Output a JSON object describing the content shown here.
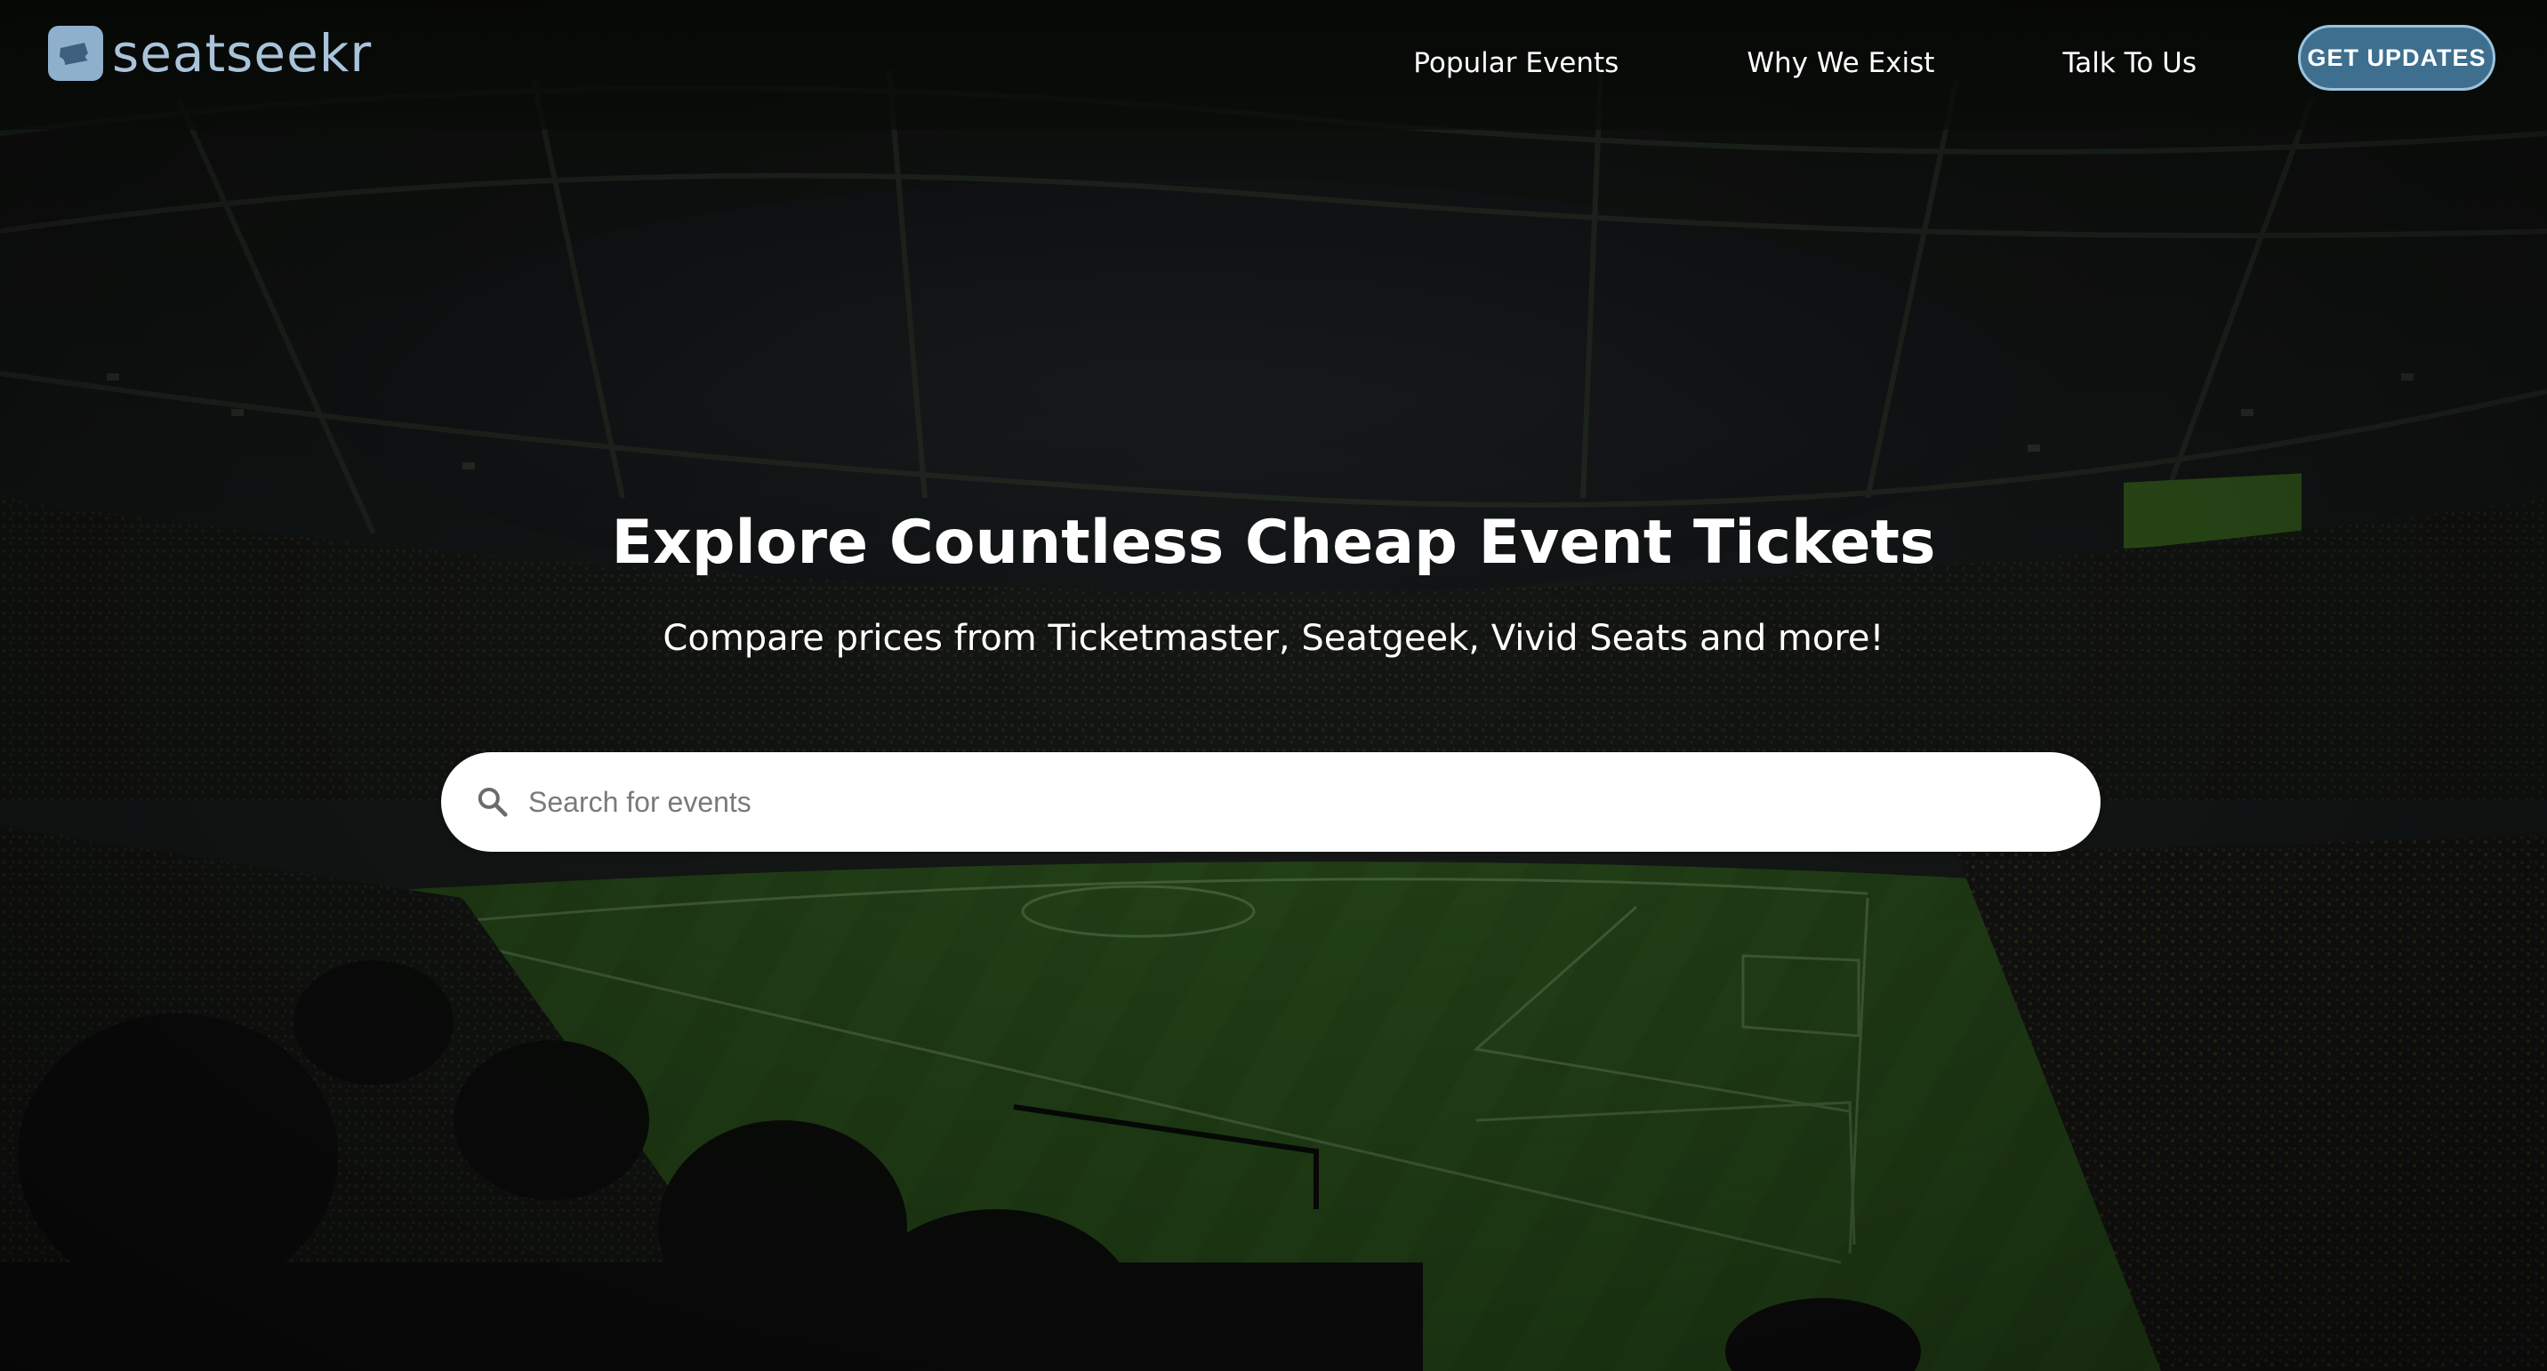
{
  "header": {
    "logo_text": "seatseekr",
    "nav": [
      {
        "label": "Popular Events"
      },
      {
        "label": "Why We Exist"
      },
      {
        "label": "Talk To Us"
      }
    ],
    "cta_label": "GET UPDATES"
  },
  "hero": {
    "title": "Explore Countless Cheap Event Tickets",
    "subtitle": "Compare prices from Ticketmaster, Seatgeek, Vivid Seats and more!"
  },
  "search": {
    "placeholder": "Search for events",
    "value": ""
  },
  "colors": {
    "brand": "#8fb0cc",
    "cta_background": "#3e6f8f",
    "cta_border": "#9cc3dc",
    "pitch_green": "#2f5a1f"
  },
  "icons": {
    "logo": "ticket-icon",
    "search": "search-icon"
  }
}
